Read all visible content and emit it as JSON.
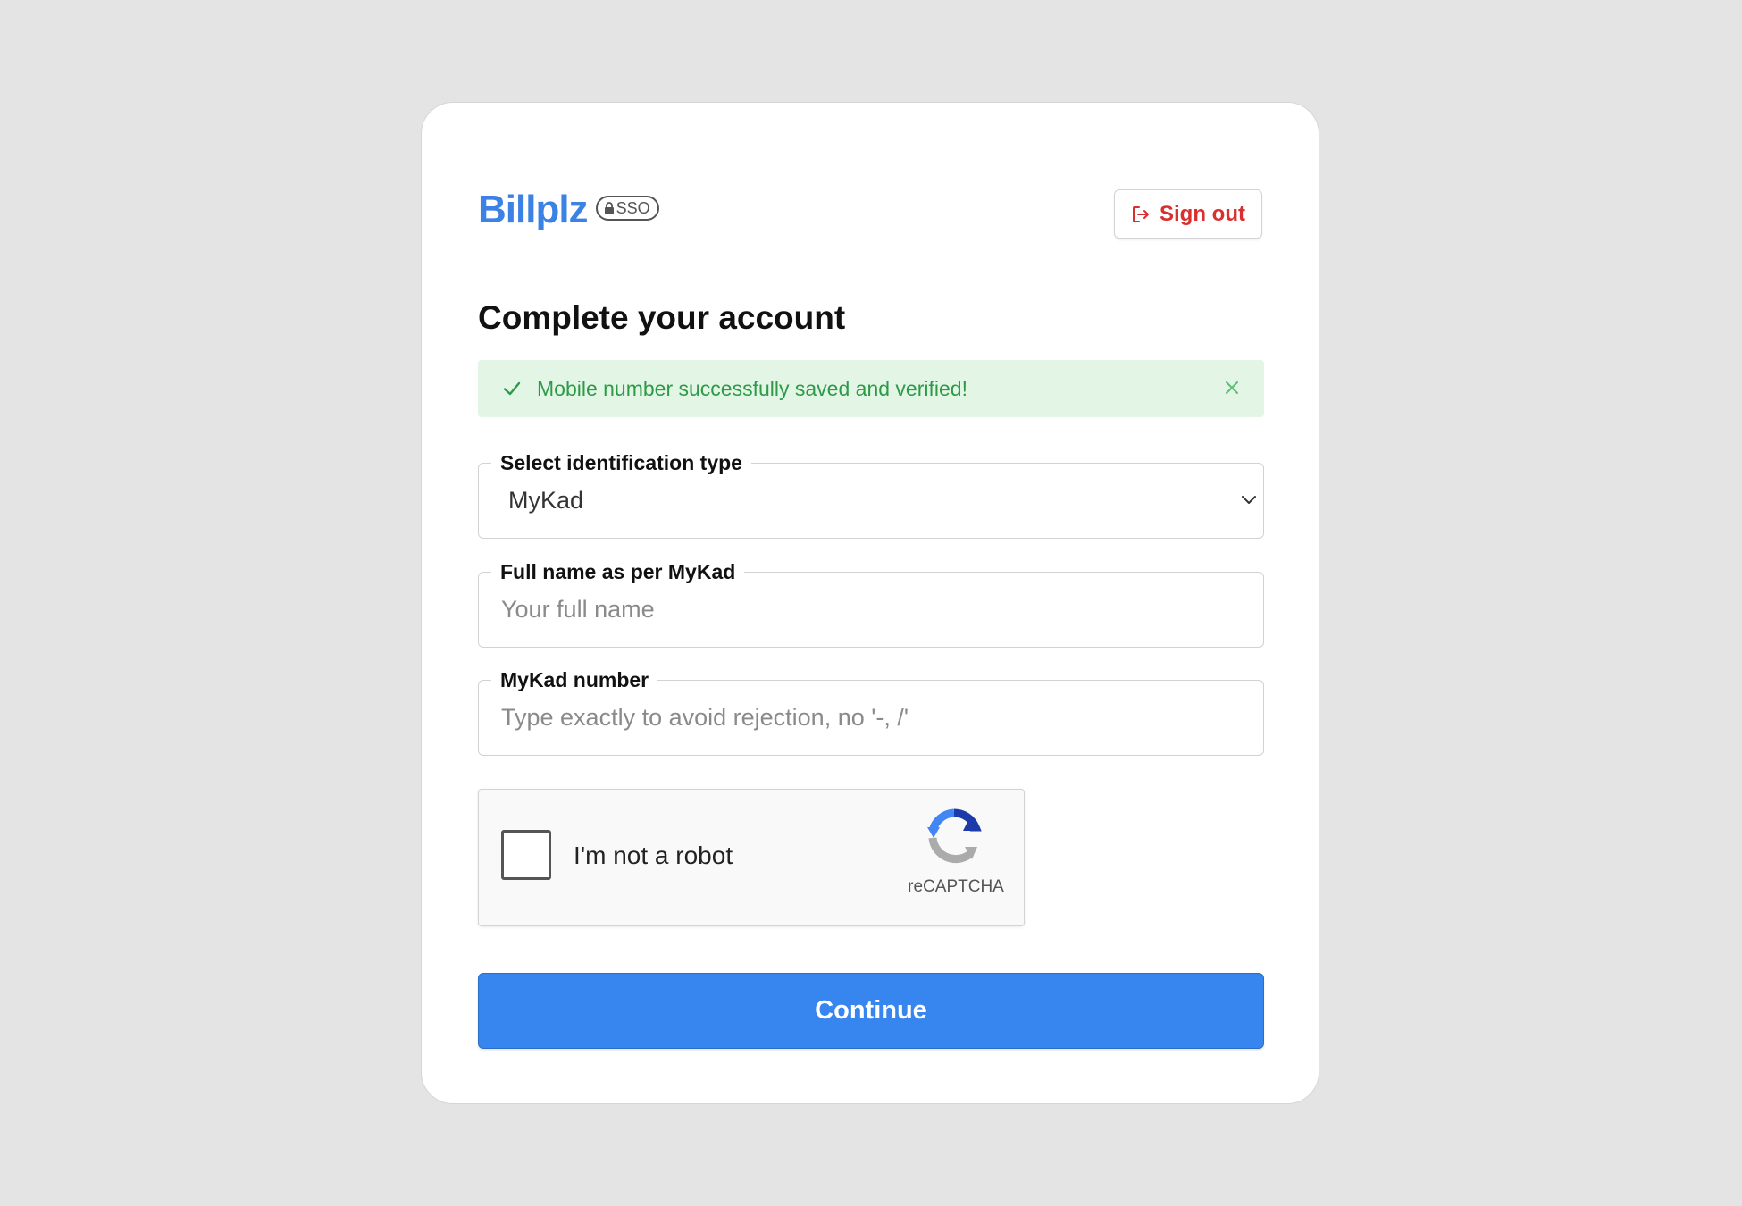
{
  "brand": {
    "name": "Billplz",
    "badge": "SSO",
    "color": "#3b82e4"
  },
  "header": {
    "signout_label": "Sign out",
    "signout_color": "#d9302f"
  },
  "page": {
    "title": "Complete your account"
  },
  "alert": {
    "message": "Mobile number successfully saved and verified!",
    "type": "success",
    "color": "#2e9a48",
    "background": "#e3f6e6"
  },
  "form": {
    "id_type": {
      "label": "Select identification type",
      "selected": "MyKad"
    },
    "full_name": {
      "label": "Full name as per MyKad",
      "placeholder": "Your full name",
      "value": ""
    },
    "id_number": {
      "label": "MyKad number",
      "placeholder": "Type exactly to avoid rejection, no '-, /'",
      "value": ""
    }
  },
  "captcha": {
    "label": "I'm not a robot",
    "brand": "reCAPTCHA",
    "checked": false
  },
  "actions": {
    "continue_label": "Continue",
    "continue_color": "#3785ee"
  }
}
